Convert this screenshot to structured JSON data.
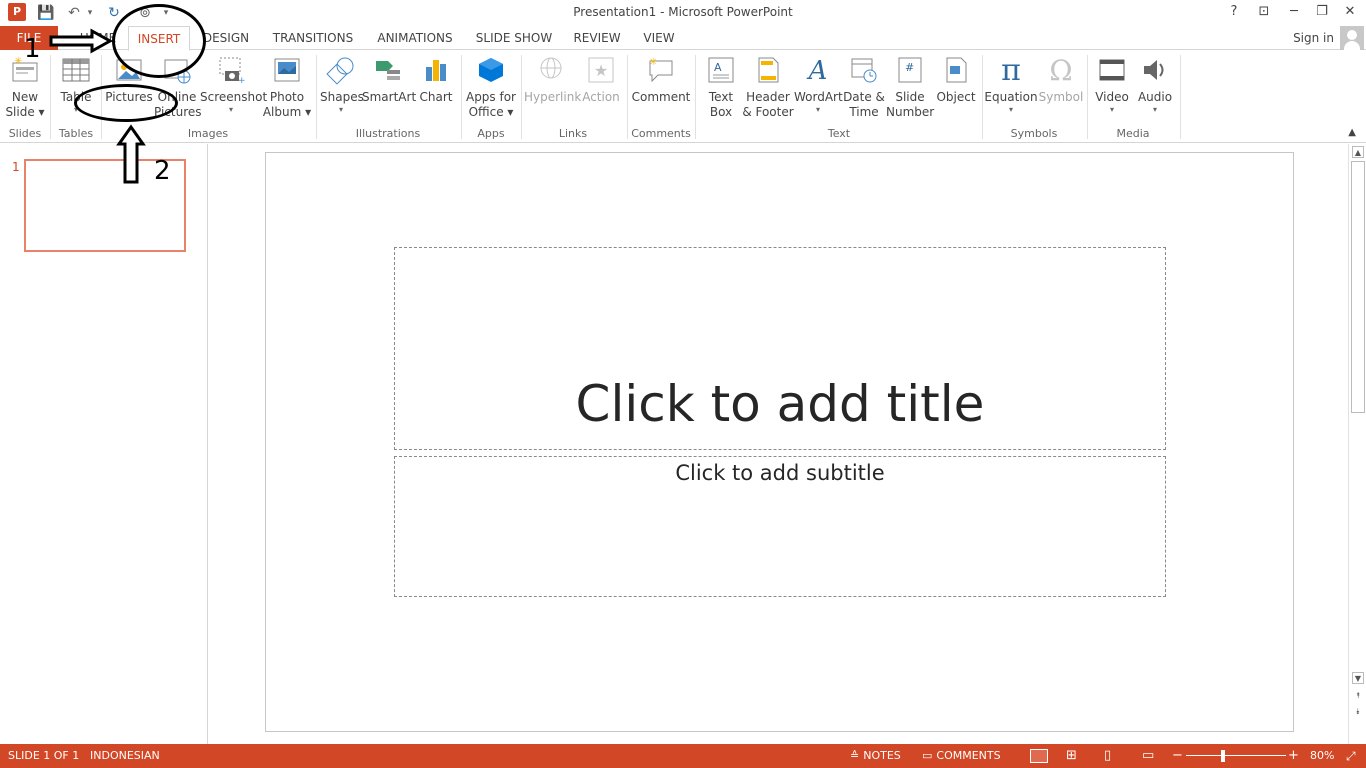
{
  "window": {
    "title": "Presentation1 - Microsoft PowerPoint",
    "app_icon_label": "P",
    "help": "?",
    "ribbon_display": "⊡",
    "minimize": "─",
    "restore": "❐",
    "close": "✕"
  },
  "qat": {
    "save": "💾",
    "undo": "↶",
    "undo_arrow": "▾",
    "redo": "↻",
    "start_slideshow": "⊚",
    "customize": "▾"
  },
  "tabs": {
    "file": "FILE",
    "home": "HOME",
    "insert": "INSERT",
    "design": "DESIGN",
    "transitions": "TRANSITIONS",
    "animations": "ANIMATIONS",
    "slide_show": "SLIDE SHOW",
    "review": "REVIEW",
    "view": "VIEW",
    "sign_in": "Sign in"
  },
  "ribbon": {
    "new_slide": [
      "New",
      "Slide ▾"
    ],
    "table": [
      "Table",
      "▾"
    ],
    "pictures": "Pictures",
    "online_pictures": [
      "Online",
      "Pictures"
    ],
    "screenshot": [
      "Screenshot",
      "▾"
    ],
    "photo_album": [
      "Photo",
      "Album ▾"
    ],
    "shapes": [
      "Shapes",
      "▾"
    ],
    "smartart": "SmartArt",
    "chart": "Chart",
    "apps_for_office": [
      "Apps for",
      "Office ▾"
    ],
    "hyperlink": "Hyperlink",
    "action": "Action",
    "comment": "Comment",
    "text_box": [
      "Text",
      "Box"
    ],
    "header_footer": [
      "Header",
      "& Footer"
    ],
    "wordart": [
      "WordArt",
      "▾"
    ],
    "date_time": [
      "Date &",
      "Time"
    ],
    "slide_number": [
      "Slide",
      "Number"
    ],
    "object": "Object",
    "equation": [
      "Equation",
      "▾"
    ],
    "symbol": "Symbol",
    "video": [
      "Video",
      "▾"
    ],
    "audio": [
      "Audio",
      "▾"
    ],
    "collapse": "▲",
    "groups": {
      "slides": "Slides",
      "tables": "Tables",
      "images": "Images",
      "illustrations": "Illustrations",
      "apps": "Apps",
      "links": "Links",
      "comments": "Comments",
      "text": "Text",
      "symbols": "Symbols",
      "media": "Media"
    }
  },
  "thumbnails": {
    "slide_number": "1"
  },
  "slide": {
    "title_placeholder": "Click to add title",
    "subtitle_placeholder": "Click to add subtitle"
  },
  "scrollbar": {
    "up": "▲",
    "down": "▼",
    "prev_slide": "⯭",
    "next_slide": "⯯"
  },
  "statusbar": {
    "slide_indicator": "SLIDE 1 OF 1",
    "language": "INDONESIAN",
    "notes": "NOTES",
    "comments": "COMMENTS",
    "zoom_out": "−",
    "zoom_in": "+",
    "zoom_level": "80%",
    "fit": "⤢"
  },
  "annotations": {
    "label_1": "1",
    "label_2": "2"
  },
  "colors": {
    "accent": "#d24726"
  }
}
